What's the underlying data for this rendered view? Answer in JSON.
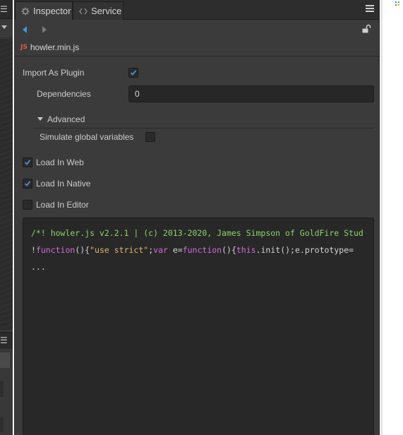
{
  "tabs": [
    {
      "label": "Inspector",
      "icon": "gear-icon",
      "active": true
    },
    {
      "label": "Service",
      "icon": "code-icon",
      "active": false
    }
  ],
  "asset": {
    "badge": "JS",
    "name": "howler.min.js"
  },
  "fields": {
    "import_as_plugin": {
      "label": "Import As Plugin",
      "checked": true
    },
    "dependencies": {
      "label": "Dependencies",
      "value": "0"
    },
    "advanced": {
      "label": "Advanced",
      "expanded": true
    },
    "simulate_global": {
      "label": "Simulate global variables",
      "checked": false
    },
    "load_in_web": {
      "label": "Load In Web",
      "checked": true
    },
    "load_in_native": {
      "label": "Load In Native",
      "checked": true
    },
    "load_in_editor": {
      "label": "Load In Editor",
      "checked": false
    }
  },
  "code": {
    "line1": "/*! howler.js v2.2.1 | (c) 2013-2020, James Simpson of GoldFire Stud",
    "line2_parts": [
      {
        "t": "!",
        "c": "punct"
      },
      {
        "t": "function",
        "c": "kw"
      },
      {
        "t": "(){",
        "c": "punct"
      },
      {
        "t": "\"use strict\"",
        "c": "str"
      },
      {
        "t": ";",
        "c": "punct"
      },
      {
        "t": "var",
        "c": "kw"
      },
      {
        "t": " e=",
        "c": "plain"
      },
      {
        "t": "function",
        "c": "kw"
      },
      {
        "t": "(){",
        "c": "punct"
      },
      {
        "t": "this",
        "c": "kw"
      },
      {
        "t": ".init();e.prototype=",
        "c": "plain"
      }
    ],
    "line3": "..."
  },
  "colors": {
    "accent_blue": "#4a90d9",
    "comment_green": "#8fd06e",
    "keyword_purple": "#d36ae0",
    "string_orange": "#e0b86a",
    "js_badge_red": "#e05a4a"
  }
}
